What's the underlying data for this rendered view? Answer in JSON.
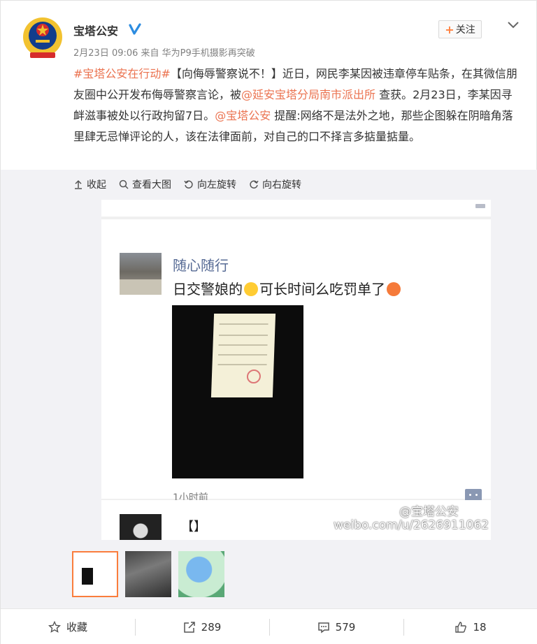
{
  "post": {
    "author": "宝塔公安",
    "verified_icon": "verified-v-icon",
    "meta": "2月23日 09:06 来自 华为P9手机摄影再突破",
    "follow_label": "关注",
    "text_parts": {
      "hashtag": "#宝塔公安在行动#",
      "part1": "【向侮辱警察说不！】近日，网民李某因被违章停车贴条，在其微信朋友圈中公开发布侮辱警察言论，被",
      "mention1": "@延安宝塔分局南市派出所",
      "part2": " 查获。2月23日，李某因寻衅滋事被处以行政拘留7日。",
      "mention2": "@宝塔公安",
      "part3": " 提醒:网络不是法外之地，那些企图躲在阴暗角落里肆无忌惮评论的人，该在法律面前，对自己的口不择言多掂量掂量。"
    }
  },
  "image_tools": {
    "collapse": "收起",
    "view_large": "查看大图",
    "rotate_left": "向左旋转",
    "rotate_right": "向右旋转"
  },
  "screenshot": {
    "poster_name": "随心随行",
    "poster_text_a": "日交警娘的",
    "poster_text_b": "可长时间么吃罚单了",
    "time": "1小时前",
    "second_text": "【】",
    "watermark_name": "@宝塔公安",
    "watermark_url": "weibo.com/u/2626911062"
  },
  "actions": {
    "favorite": "收藏",
    "repost_count": "289",
    "comment_count": "579",
    "like_count": "18"
  },
  "colors": {
    "link": "#eb7350",
    "accent": "#fa7d3c",
    "name_blue": "#576b95"
  }
}
